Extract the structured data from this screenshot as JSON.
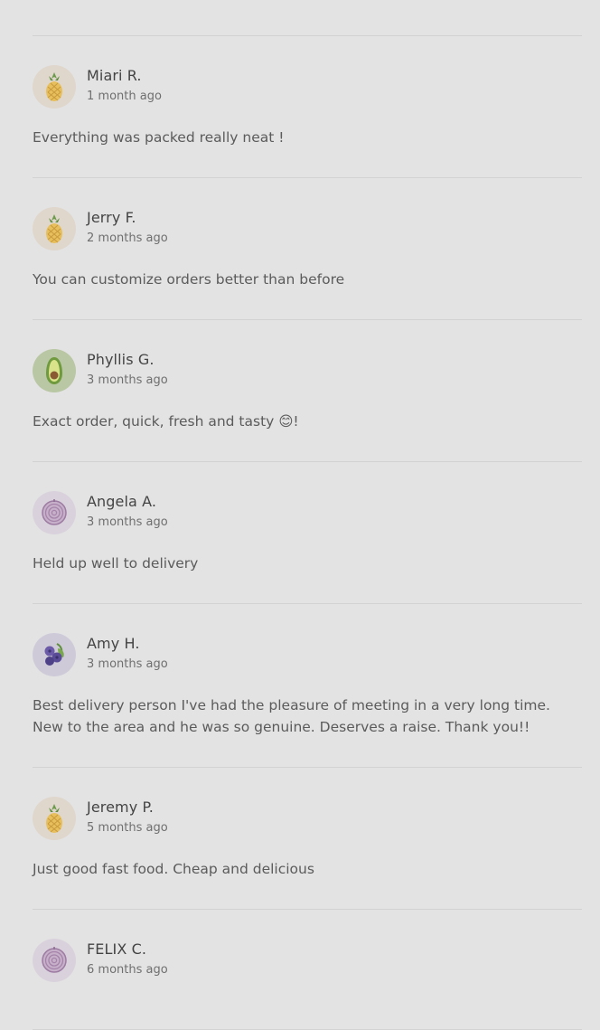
{
  "reviews": [
    {
      "name": "Miari R.",
      "time": "1 month ago",
      "text": "Everything was packed really neat !",
      "avatar": "pineapple-icon"
    },
    {
      "name": "Jerry F.",
      "time": "2 months ago",
      "text": "You can customize orders better than before",
      "avatar": "pineapple-icon"
    },
    {
      "name": "Phyllis G.",
      "time": "3 months ago",
      "text": "Exact order, quick, fresh and tasty 😊!",
      "avatar": "avocado-icon"
    },
    {
      "name": "Angela A.",
      "time": "3 months ago",
      "text": "Held up well to delivery",
      "avatar": "onion-icon"
    },
    {
      "name": "Amy H.",
      "time": "3 months ago",
      "text": "Best delivery person I've had the pleasure of meeting in a very long time. New to the area and he was so genuine. Deserves a raise. Thank you!!",
      "avatar": "blueberry-icon"
    },
    {
      "name": "Jeremy P.",
      "time": "5 months ago",
      "text": "Just good fast food. Cheap and delicious",
      "avatar": "pineapple-icon"
    },
    {
      "name": "FELIX C.",
      "time": "6 months ago",
      "text": "",
      "avatar": "onion-icon"
    }
  ]
}
